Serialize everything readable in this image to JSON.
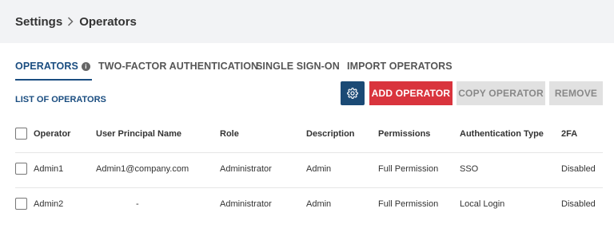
{
  "breadcrumb": {
    "root": "Settings",
    "current": "Operators"
  },
  "tabs": [
    {
      "label": "OPERATORS",
      "active": true
    },
    {
      "label": "TWO-FACTOR AUTHENTICATION",
      "active": false
    },
    {
      "label": "SINGLE SIGN-ON",
      "active": false
    },
    {
      "label": "IMPORT OPERATORS",
      "active": false
    }
  ],
  "toolbar": {
    "list_title": "LIST OF OPERATORS",
    "settings_icon": "gear-icon",
    "add_label": "ADD OPERATOR",
    "copy_label": "COPY OPERATOR",
    "remove_label": "REMOVE"
  },
  "table": {
    "columns": [
      "Operator",
      "User Principal Name",
      "Role",
      "Description",
      "Permissions",
      "Authentication Type",
      "2FA"
    ],
    "rows": [
      {
        "operator": "Admin1",
        "upn": "Admin1@company.com",
        "role": "Administrator",
        "description": "Admin",
        "permissions": "Full Permission",
        "auth": "SSO",
        "twofa": "Disabled"
      },
      {
        "operator": "Admin2",
        "upn": "-",
        "role": "Administrator",
        "description": "Admin",
        "permissions": "Full Permission",
        "auth": "Local Login",
        "twofa": "Disabled"
      }
    ]
  },
  "colors": {
    "primary": "#1a4d80",
    "danger": "#d9343d",
    "disabled": "#e1e1e1",
    "header_bg": "#f2f3f5"
  }
}
